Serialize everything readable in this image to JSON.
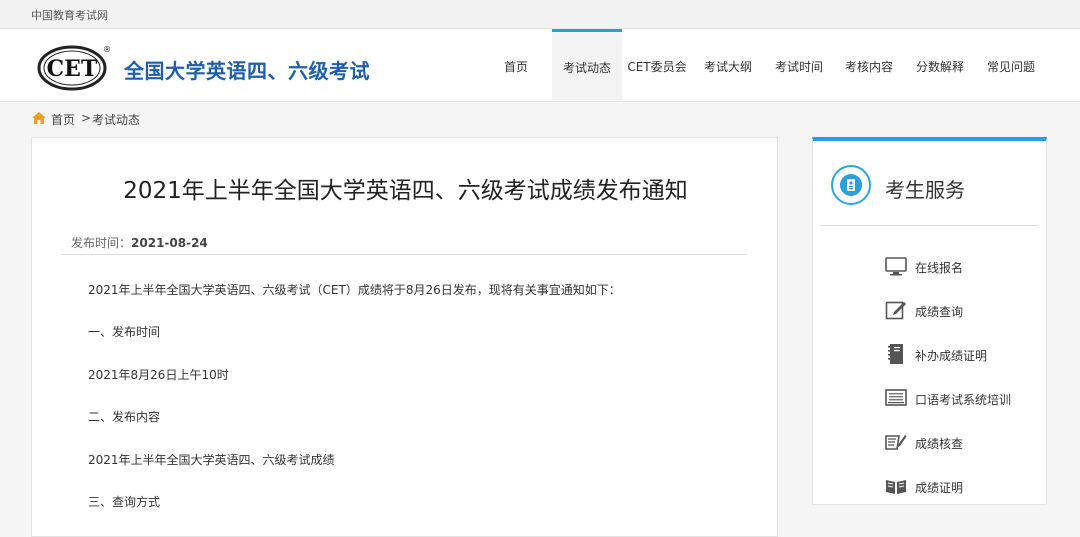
{
  "topbar": {
    "site_name": "中国教育考试网"
  },
  "header": {
    "logo_text": "CET",
    "logo_mark": "®",
    "brand_title": "全国大学英语四、六级考试"
  },
  "nav": {
    "items": [
      {
        "label": "首页",
        "active": false
      },
      {
        "label": "考试动态",
        "active": true
      },
      {
        "label": "CET委员会",
        "active": false
      },
      {
        "label": "考试大纲",
        "active": false
      },
      {
        "label": "考试时间",
        "active": false
      },
      {
        "label": "考核内容",
        "active": false
      },
      {
        "label": "分数解释",
        "active": false
      },
      {
        "label": "常见问题",
        "active": false
      }
    ]
  },
  "breadcrumb": {
    "home": "首页",
    "separator": ">",
    "current": "考试动态"
  },
  "article": {
    "title": "2021年上半年全国大学英语四、六级考试成绩发布通知",
    "publish_label": "发布时间：",
    "publish_date": "2021-08-24",
    "paragraphs": [
      "2021年上半年全国大学英语四、六级考试（CET）成绩将于8月26日发布，现将有关事宜通知如下：",
      "一、发布时间",
      "2021年8月26日上午10时",
      "二、发布内容",
      "2021年上半年全国大学英语四、六级考试成绩",
      "三、查询方式"
    ]
  },
  "sidebar": {
    "title": "考生服务",
    "services": [
      {
        "label": "在线报名",
        "icon": "monitor-icon"
      },
      {
        "label": "成绩查询",
        "icon": "edit-icon"
      },
      {
        "label": "补办成绩证明",
        "icon": "notebook-icon"
      },
      {
        "label": "口语考试系统培训",
        "icon": "keyboard-icon"
      },
      {
        "label": "成绩核查",
        "icon": "book-pen-icon"
      },
      {
        "label": "成绩证明",
        "icon": "open-book-icon"
      }
    ]
  },
  "colors": {
    "accent": "#22a2dc",
    "brand": "#1f5fa8"
  }
}
